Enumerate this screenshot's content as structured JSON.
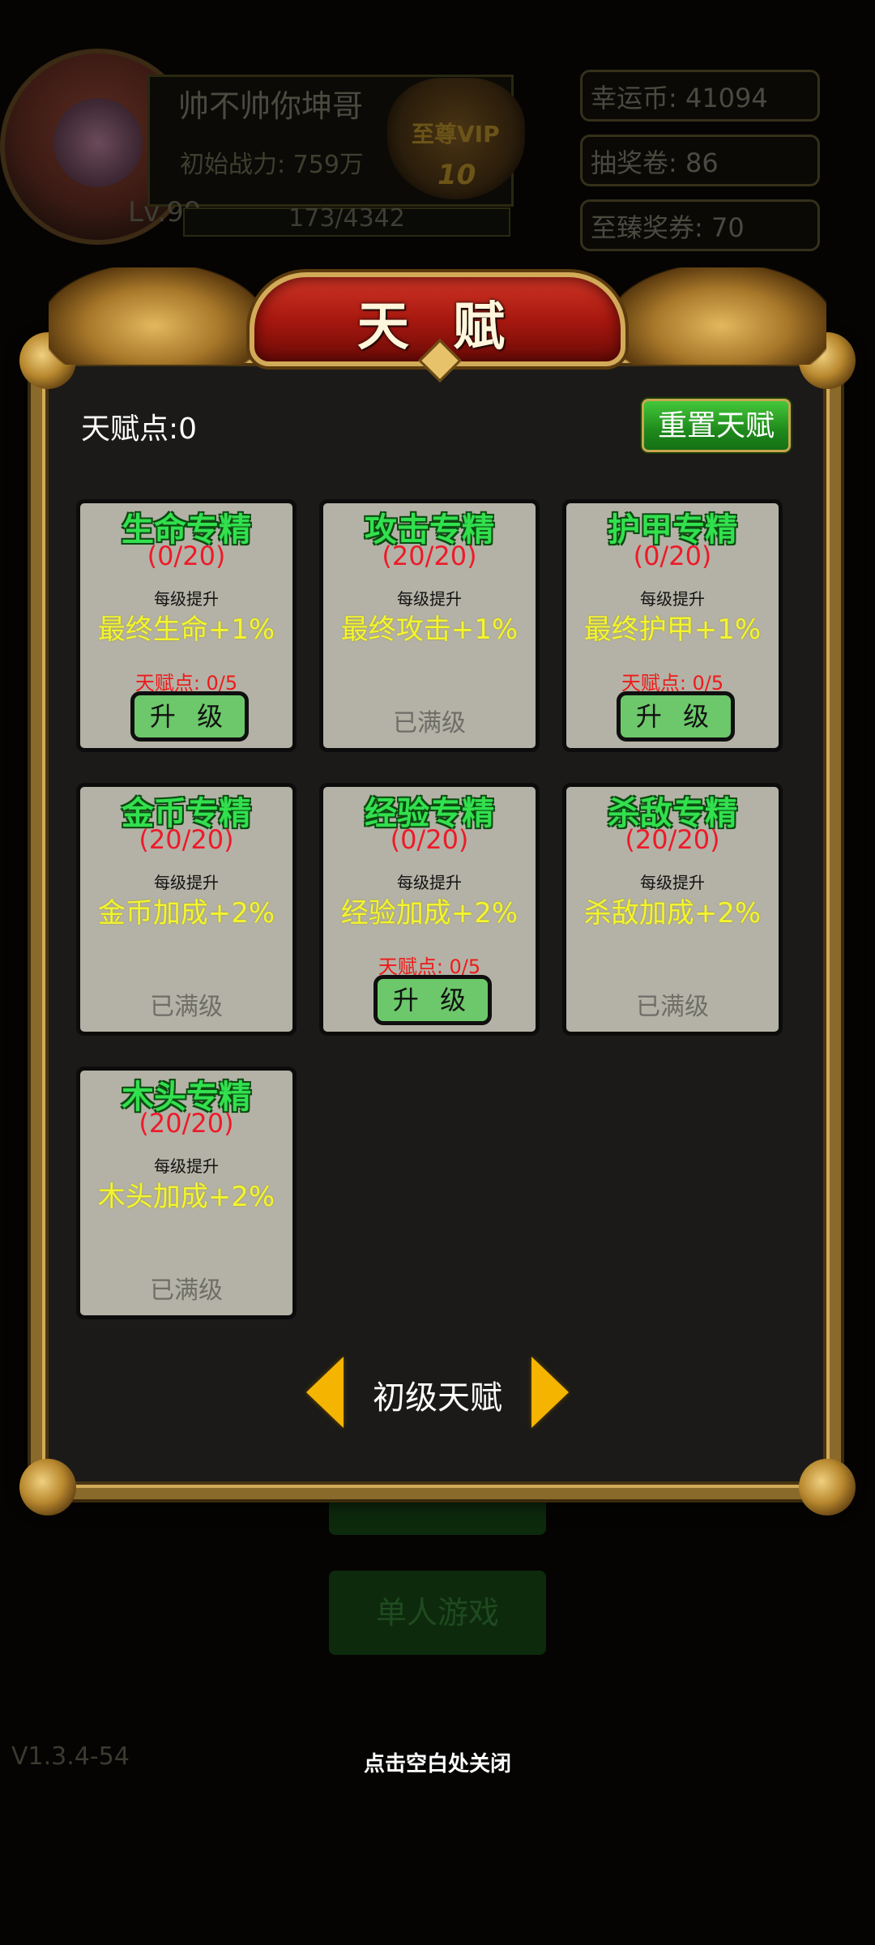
{
  "background": {
    "player_name": "帅不帅你坤哥",
    "power": "初始战力: 759万",
    "level": "Lv.99",
    "exp": "173/4342",
    "vip_label": "至尊VIP",
    "vip_level": "10",
    "stats": [
      "幸运币: 41094",
      "抽奖卷: 86",
      "至臻奖券: 70"
    ],
    "buttons": [
      "单人游戏"
    ],
    "version": "V1.3.4-54"
  },
  "panel": {
    "title": "天 赋",
    "points_label": "天赋点:0",
    "reset_label": "重置天赋"
  },
  "cards": [
    {
      "title": "生命专精",
      "level": "(0/20)",
      "sub": "每级提升",
      "bonus": "最终生命+1%",
      "cost": "天赋点: 0/5",
      "action": "升 级",
      "maxed": ""
    },
    {
      "title": "攻击专精",
      "level": "(20/20)",
      "sub": "每级提升",
      "bonus": "最终攻击+1%",
      "cost": "",
      "action": "",
      "maxed": "已满级"
    },
    {
      "title": "护甲专精",
      "level": "(0/20)",
      "sub": "每级提升",
      "bonus": "最终护甲+1%",
      "cost": "天赋点: 0/5",
      "action": "升 级",
      "maxed": ""
    },
    {
      "title": "金币专精",
      "level": "(20/20)",
      "sub": "每级提升",
      "bonus": "金币加成+2%",
      "cost": "",
      "action": "",
      "maxed": "已满级"
    },
    {
      "title": "经验专精",
      "level": "(0/20)",
      "sub": "每级提升",
      "bonus": "经验加成+2%",
      "cost": "天赋点: 0/5",
      "action": "升 级",
      "maxed": ""
    },
    {
      "title": "杀敌专精",
      "level": "(20/20)",
      "sub": "每级提升",
      "bonus": "杀敌加成+2%",
      "cost": "",
      "action": "",
      "maxed": "已满级"
    },
    {
      "title": "木头专精",
      "level": "(20/20)",
      "sub": "每级提升",
      "bonus": "木头加成+2%",
      "cost": "",
      "action": "",
      "maxed": "已满级"
    }
  ],
  "tier": {
    "label": "初级天赋"
  },
  "close_hint": "点击空白处关闭"
}
